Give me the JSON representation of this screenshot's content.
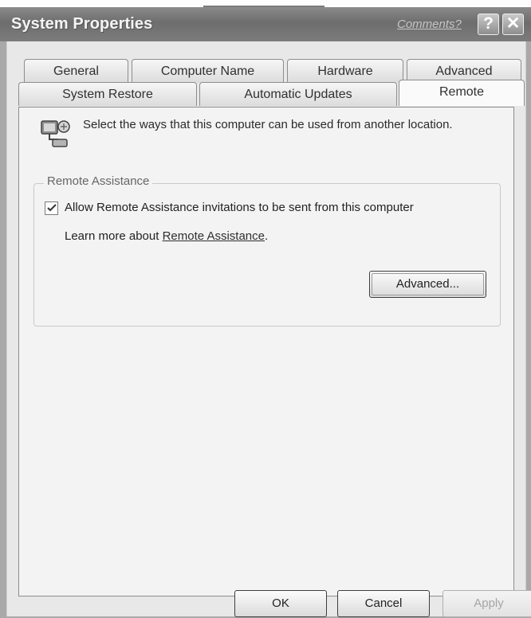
{
  "window": {
    "title": "System Properties",
    "comments_link": "Comments?",
    "help_button": "?",
    "close_button": "✕"
  },
  "tabs": {
    "row1": [
      "General",
      "Computer Name",
      "Hardware",
      "Advanced"
    ],
    "row2": [
      "System Restore",
      "Automatic Updates",
      "Remote"
    ],
    "active": "Remote"
  },
  "remote_panel": {
    "intro": "Select the ways that this computer can be used from another location.",
    "group_label": "Remote Assistance",
    "checkbox_label": "Allow Remote Assistance invitations to be sent from this computer",
    "checkbox_checked": true,
    "learn_more_prefix": "Learn more about",
    "learn_more_link": "Remote Assistance",
    "learn_more_suffix": ".",
    "advanced_button": "Advanced..."
  },
  "footer": {
    "ok": "OK",
    "cancel": "Cancel",
    "apply": "Apply"
  },
  "icons": {
    "remote": "remote-computer-icon",
    "check": "checkmark-icon"
  }
}
